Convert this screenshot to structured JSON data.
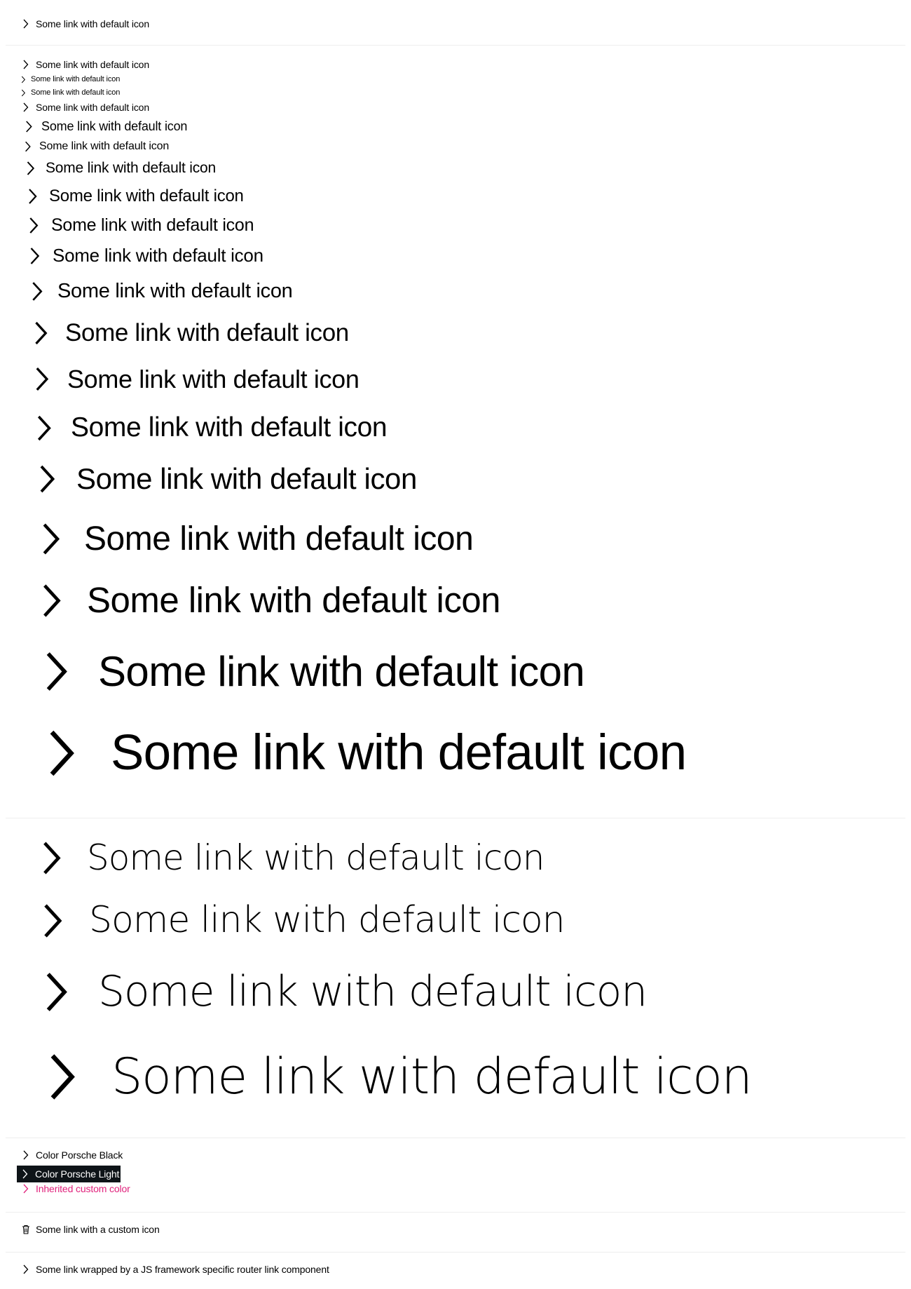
{
  "default_link_text": "Some link with default icon",
  "colors": {
    "porsche_black": "#000000",
    "porsche_light_background": "#0e1418",
    "porsche_light_text": "#ffffff",
    "custom_color": "#e0227c",
    "separator": "#eeeeee"
  },
  "sections": {
    "basic": {
      "link_text": "Some link with default icon",
      "icon": "chevron-right-icon"
    },
    "sizes": {
      "link_text": "Some link with default icon",
      "icon": "chevron-right-icon",
      "items": [
        "Some link with default icon",
        "Some link with default icon",
        "Some link with default icon",
        "Some link with default icon",
        "Some link with default icon",
        "Some link with default icon",
        "Some link with default icon",
        "Some link with default icon",
        "Some link with default icon",
        "Some link with default icon",
        "Some link with default icon",
        "Some link with default icon",
        "Some link with default icon",
        "Some link with default icon",
        "Some link with default icon",
        "Some link with default icon",
        "Some link with default icon",
        "Some link with default icon",
        "Some link with default icon"
      ]
    },
    "thin_sizes": {
      "items": [
        "Some link with default icon",
        "Some link with default icon",
        "Some link with default icon",
        "Some link with default icon"
      ]
    },
    "colors": {
      "black_label": "Color Porsche Black",
      "light_label": "Color Porsche Light",
      "custom_label": "Inherited custom color"
    },
    "custom_icon": {
      "label": "Some link with a custom icon",
      "icon": "trash-icon"
    },
    "router": {
      "label": "Some link wrapped by a JS framework specific router link component"
    }
  }
}
